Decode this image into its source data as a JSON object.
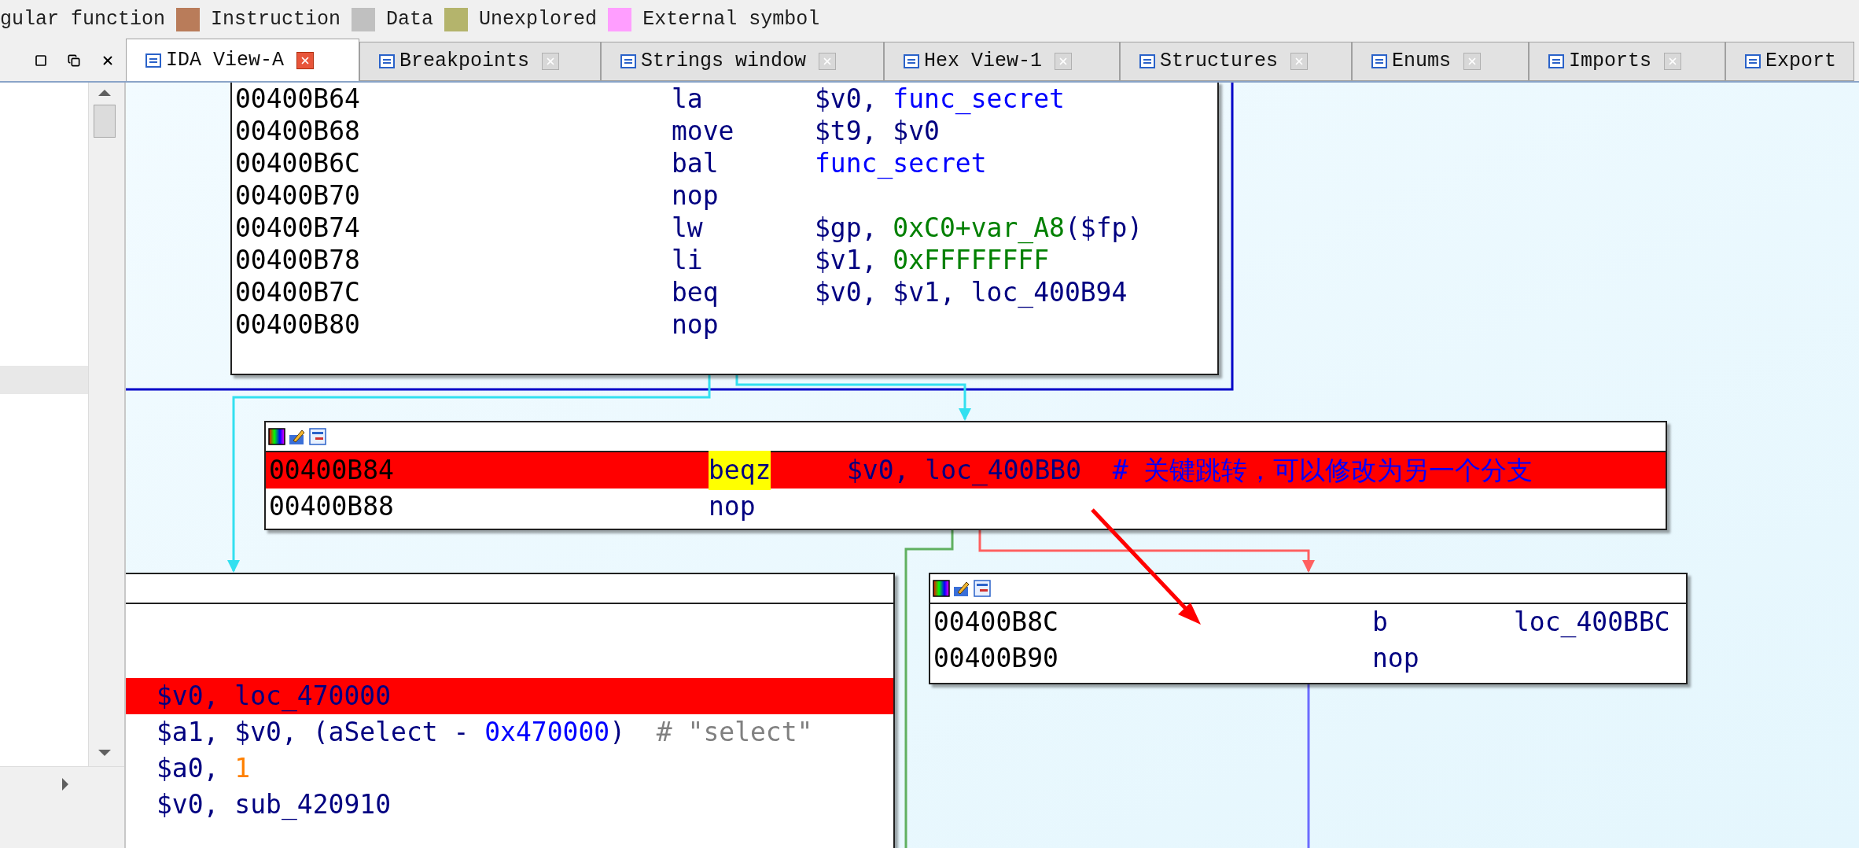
{
  "legend": [
    {
      "label": "gular function"
    },
    {
      "label": "Instruction",
      "color": "#b97c5a"
    },
    {
      "label": "Data",
      "color": "#c0c0c0"
    },
    {
      "label": "Unexplored",
      "color": "#b4b46c"
    },
    {
      "label": "External symbol",
      "color": "#ff9eff"
    }
  ],
  "tabs": [
    {
      "label": "IDA View-A",
      "selected": true
    },
    {
      "label": "Breakpoints",
      "selected": false
    },
    {
      "label": "Strings window",
      "selected": false
    },
    {
      "label": "Hex View-1",
      "selected": false
    },
    {
      "label": "Structures",
      "selected": false
    },
    {
      "label": "Enums",
      "selected": false
    },
    {
      "label": "Imports",
      "selected": false
    },
    {
      "label": "Export",
      "selected": false
    }
  ],
  "graph": {
    "nodes": [
      {
        "rows": [
          {
            "address": "00400B64",
            "mnemonic": "la",
            "highlighted": false,
            "operands": [
              {
                "text": "$v0, ",
                "kind": "register"
              },
              {
                "text": "func_secret",
                "kind": "name"
              }
            ]
          },
          {
            "address": "00400B68",
            "mnemonic": "move",
            "highlighted": false,
            "operands": [
              {
                "text": "$t9, $v0",
                "kind": "register"
              }
            ]
          },
          {
            "address": "00400B6C",
            "mnemonic": "bal",
            "highlighted": false,
            "operands": [
              {
                "text": "func_secret",
                "kind": "name"
              }
            ]
          },
          {
            "address": "00400B70",
            "mnemonic": "nop",
            "highlighted": false,
            "operands": []
          },
          {
            "address": "00400B74",
            "mnemonic": "lw",
            "highlighted": false,
            "operands": [
              {
                "text": "$gp, ",
                "kind": "register"
              },
              {
                "text": "0xC0+var_A8",
                "kind": "number"
              },
              {
                "text": "($fp)",
                "kind": "register"
              }
            ]
          },
          {
            "address": "00400B78",
            "mnemonic": "li",
            "highlighted": false,
            "operands": [
              {
                "text": "$v1, ",
                "kind": "register"
              },
              {
                "text": "0xFFFFFFFF",
                "kind": "number"
              }
            ]
          },
          {
            "address": "00400B7C",
            "mnemonic": "beq",
            "highlighted": false,
            "operands": [
              {
                "text": "$v0, $v1, loc_400B94",
                "kind": "register"
              }
            ]
          },
          {
            "address": "00400B80",
            "mnemonic": "nop",
            "highlighted": false,
            "operands": []
          }
        ]
      },
      {
        "rows": [
          {
            "address": "00400B84",
            "mnemonic": "beqz",
            "highlighted": true,
            "mnemonic_highlighted": true,
            "operands": [
              {
                "text": "$v0, loc_400BB0",
                "kind": "register"
              },
              {
                "text": "  # 关键跳转，可以修改为另一个分支",
                "kind": "note"
              }
            ]
          },
          {
            "address": "00400B88",
            "mnemonic": "nop",
            "highlighted": false,
            "mnemonic_highlighted": false,
            "operands": []
          }
        ]
      },
      {
        "rows": [
          {
            "highlighted": true,
            "operands": [
              {
                "text": "$v0, loc_470000",
                "kind": "register"
              }
            ]
          },
          {
            "highlighted": false,
            "operands": [
              {
                "text": "$a1, $v0, (aSelect - ",
                "kind": "register"
              },
              {
                "text": "0x470000",
                "kind": "name"
              },
              {
                "text": ")",
                "kind": "register"
              },
              {
                "text": "  # \"select\"",
                "kind": "comment"
              }
            ]
          },
          {
            "highlighted": false,
            "operands": [
              {
                "text": "$a0, ",
                "kind": "register"
              },
              {
                "text": "1",
                "kind": "immediate"
              }
            ]
          },
          {
            "highlighted": false,
            "operands": [
              {
                "text": "$v0, sub_420910",
                "kind": "register"
              }
            ]
          }
        ]
      },
      {
        "rows": [
          {
            "address": "00400B8C",
            "mnemonic": "b",
            "highlighted": false,
            "operands": [
              {
                "text": "loc_400BBC",
                "kind": "register"
              }
            ]
          },
          {
            "address": "00400B90",
            "mnemonic": "nop",
            "highlighted": false,
            "operands": []
          }
        ]
      }
    ]
  }
}
